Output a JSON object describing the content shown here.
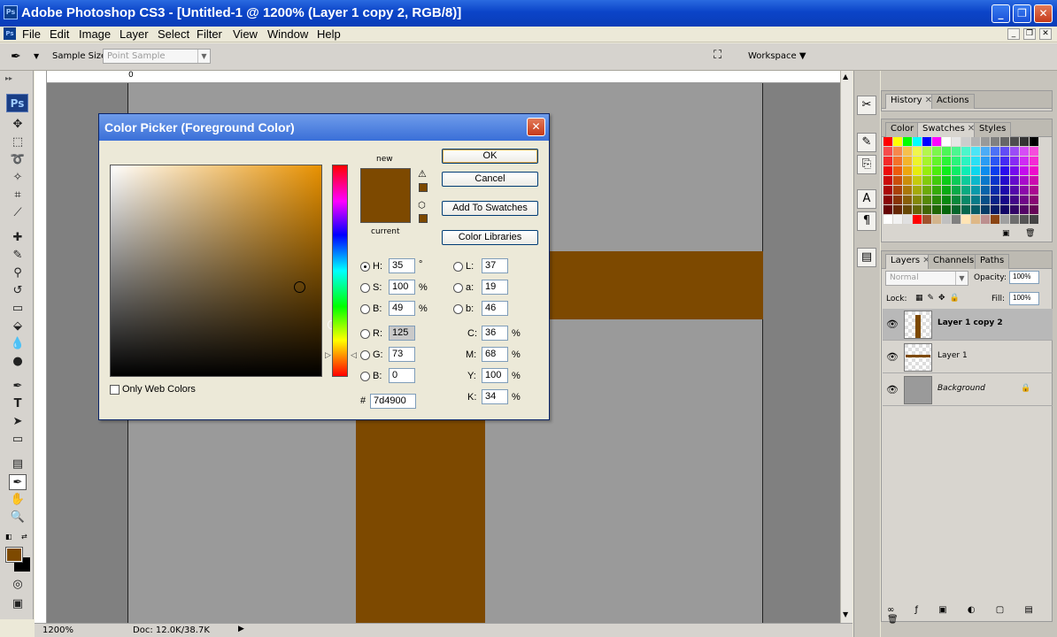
{
  "window": {
    "title": "Adobe Photoshop CS3 - [Untitled-1 @ 1200% (Layer 1 copy 2, RGB/8)]"
  },
  "menu": [
    "File",
    "Edit",
    "Image",
    "Layer",
    "Select",
    "Filter",
    "View",
    "Window",
    "Help"
  ],
  "options": {
    "sample_size_label": "Sample Size:",
    "sample_size_value": "Point Sample",
    "workspace": "Workspace ▼"
  },
  "status": {
    "zoom": "1200%",
    "doc": "Doc: 12.0K/38.7K"
  },
  "colors": {
    "foreground": "#7d4900",
    "accent_brown": "#7d4900",
    "title_blue": "#0b44c8"
  },
  "dialog": {
    "title": "Color Picker (Foreground Color)",
    "new_label": "new",
    "current_label": "current",
    "ok": "OK",
    "cancel": "Cancel",
    "add_swatches": "Add To Swatches",
    "libraries": "Color Libraries",
    "only_web": "Only Web Colors",
    "H": "35",
    "S": "100",
    "B_hsb": "49",
    "R": "125",
    "G": "73",
    "B_rgb": "0",
    "L": "37",
    "a": "19",
    "b_lab": "46",
    "C": "36",
    "M": "68",
    "Y": "100",
    "K": "34",
    "hex": "7d4900",
    "labels": {
      "H": "H:",
      "S": "S:",
      "B": "B:",
      "R": "R:",
      "G": "G:",
      "Bb": "B:",
      "L": "L:",
      "a": "a:",
      "b": "b:",
      "C": "C:",
      "M": "M:",
      "Y": "Y:",
      "K": "K:",
      "hash": "#"
    },
    "units": {
      "deg": "°",
      "pct": "%"
    }
  },
  "panels": {
    "top_tabs": [
      "History",
      "Actions"
    ],
    "mid_tabs": [
      "Color",
      "Swatches",
      "Styles"
    ],
    "layer_tabs": [
      "Layers",
      "Channels",
      "Paths"
    ],
    "blend_mode": "Normal",
    "opacity_label": "Opacity:",
    "opacity": "100%",
    "lock_label": "Lock:",
    "fill_label": "Fill:",
    "fill": "100%",
    "layers": [
      "Layer 1 copy 2",
      "Layer 1",
      "Background"
    ]
  }
}
